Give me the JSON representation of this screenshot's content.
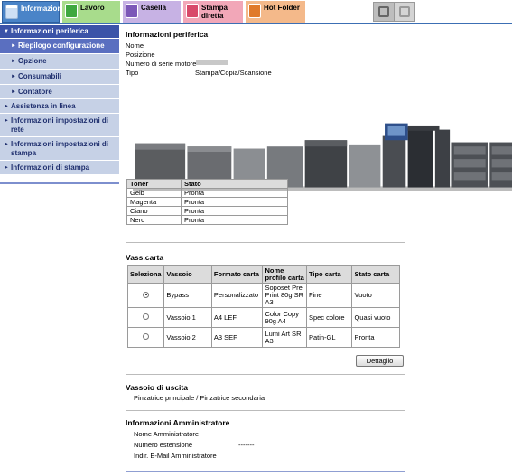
{
  "tabs": [
    {
      "label": "Informazione",
      "icon": "info-icon"
    },
    {
      "label": "Lavoro",
      "icon": "job-icon"
    },
    {
      "label": "Casella",
      "icon": "box-icon"
    },
    {
      "label": "Stampa\ndiretta",
      "icon": "direct-print-icon"
    },
    {
      "label": "Hot Folder",
      "icon": "hot-folder-icon"
    }
  ],
  "toolbar": {
    "icons": [
      "device-settings-icon",
      "display-icon"
    ]
  },
  "sidebar": {
    "items": [
      {
        "label": "Informazioni periferica"
      },
      {
        "label": "Riepilogo configurazione"
      },
      {
        "label": "Opzione"
      },
      {
        "label": "Consumabili"
      },
      {
        "label": "Contatore"
      },
      {
        "label": "Assistenza in linea"
      },
      {
        "label": "Informazioni impostazioni di rete"
      },
      {
        "label": "Informazioni impostazioni di stampa"
      },
      {
        "label": "Informazioni di stampa"
      }
    ]
  },
  "device": {
    "title": "Informazioni periferica",
    "name_label": "Nome",
    "position_label": "Posizione",
    "serial_label": "Numero di serie motore",
    "type_label": "Tipo",
    "type_value": "Stampa/Copia/Scansione"
  },
  "toner": {
    "headers": [
      "Toner",
      "Stato"
    ],
    "rows": [
      [
        "Gelb",
        "Pronta"
      ],
      [
        "Magenta",
        "Pronta"
      ],
      [
        "Ciano",
        "Pronta"
      ],
      [
        "Nero",
        "Pronta"
      ]
    ]
  },
  "paper": {
    "title": "Vass.carta",
    "headers": [
      "Seleziona",
      "Vassoio",
      "Formato carta",
      "Nome profilo carta",
      "Tipo carta",
      "Stato carta"
    ],
    "rows": [
      {
        "selected": true,
        "tray": "Bypass",
        "format": "Personalizzato",
        "profile": "Soposet Pre Print 80g SR A3",
        "type": "Fine",
        "status": "Vuoto"
      },
      {
        "selected": false,
        "tray": "Vassoio 1",
        "format": "A4 LEF",
        "profile": "Color Copy 90g A4",
        "type": "Spec colore",
        "status": "Quasi vuoto"
      },
      {
        "selected": false,
        "tray": "Vassoio 2",
        "format": "A3 SEF",
        "profile": "Lumi Art SR A3",
        "type": "Patin-GL",
        "status": "Pronta"
      }
    ],
    "detail_button": "Dettaglio"
  },
  "output": {
    "title": "Vassoio di uscita",
    "value": "Pinzatrice principale / Pinzatrice secondaria"
  },
  "admin": {
    "title": "Informazioni Amministratore",
    "name_label": "Nome Amministratore",
    "ext_label": "Numero estensione",
    "ext_value": "-------",
    "email_label": "Indir. E-Mail Amministratore"
  }
}
